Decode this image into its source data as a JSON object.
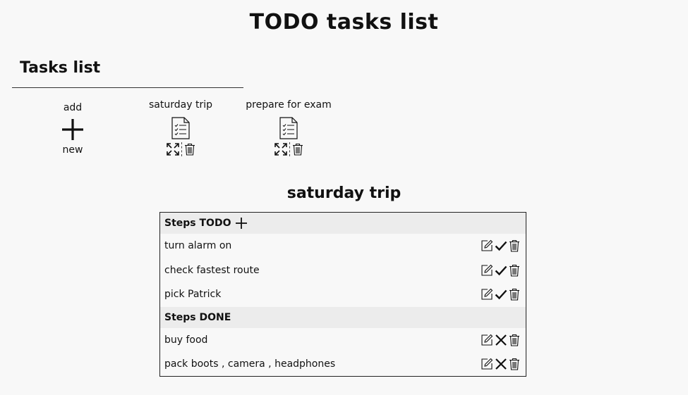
{
  "page": {
    "title": "TODO tasks list"
  },
  "tasks_list": {
    "title": "Tasks list",
    "add_new": {
      "top_label": "add",
      "bottom_label": "new"
    },
    "tasks": [
      {
        "name": "saturday trip"
      },
      {
        "name": "prepare for exam"
      }
    ]
  },
  "detail": {
    "title": "saturday trip",
    "todo_header": "Steps TODO",
    "done_header": "Steps DONE",
    "todo_steps": [
      {
        "text": "turn alarm on"
      },
      {
        "text": "check fastest route"
      },
      {
        "text": "pick Patrick"
      }
    ],
    "done_steps": [
      {
        "text": "buy food"
      },
      {
        "text": "pack boots , camera , headphones"
      }
    ]
  },
  "icons": {
    "add": "plus-icon",
    "task": "document-icon",
    "expand": "expand-icon",
    "delete": "trash-icon",
    "edit": "edit-icon",
    "complete": "check-icon",
    "undo": "x-icon"
  }
}
